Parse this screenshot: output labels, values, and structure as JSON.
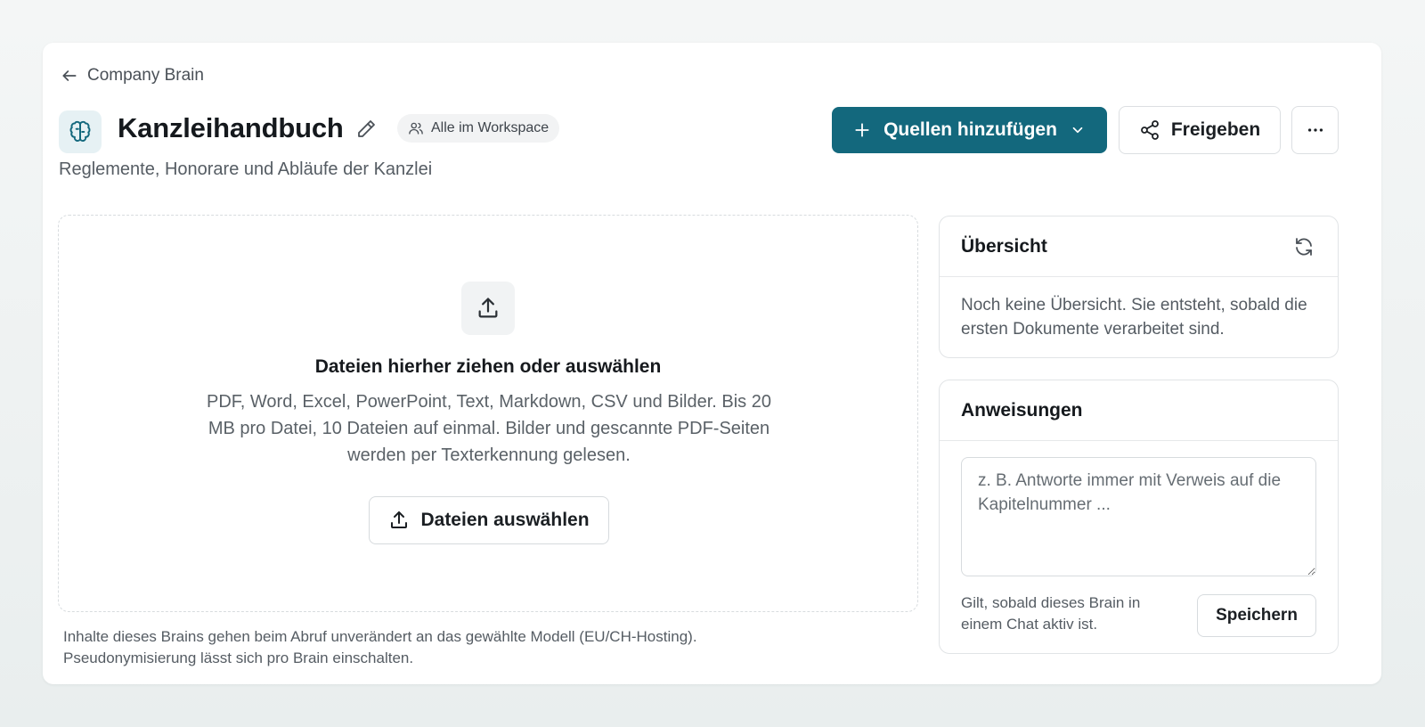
{
  "breadcrumb": {
    "back_label": "Company Brain"
  },
  "header": {
    "title": "Kanzleihandbuch",
    "visibility_label": "Alle im Workspace",
    "subtitle": "Reglemente, Honorare und Abläufe der Kanzlei"
  },
  "toolbar": {
    "add_sources_label": "Quellen hinzufügen",
    "share_label": "Freigeben",
    "more_label": "…"
  },
  "dropzone": {
    "title": "Dateien hierher ziehen oder auswählen",
    "description": "PDF, Word, Excel, PowerPoint, Text, Markdown, CSV und Bilder. Bis 20 MB pro Datei, 10 Dateien auf einmal. Bilder und gescannte PDF-Seiten werden per Texterkennung gelesen.",
    "button_label": "Dateien auswählen"
  },
  "footnote": {
    "line1": "Inhalte dieses Brains gehen beim Abruf unverändert an das gewählte Modell (EU/CH-Hosting).",
    "line2": "Pseudonymisierung lässt sich pro Brain einschalten."
  },
  "overview": {
    "title": "Übersicht",
    "empty_text": "Noch keine Übersicht. Sie entsteht, sobald die ersten Dokumente verarbeitet sind."
  },
  "instructions": {
    "title": "Anweisungen",
    "placeholder": "z. B. Antworte immer mit Verweis auf die Kapitelnummer ...",
    "value": "",
    "hint": "Gilt, sobald dieses Brain in einem Chat aktiv ist.",
    "save_label": "Speichern"
  },
  "colors": {
    "primary": "#13687d",
    "brain_badge_bg": "#e6f1f4",
    "brain_icon": "#13687d"
  },
  "icons": {
    "back": "arrow-left-icon",
    "brain": "brain-icon",
    "edit": "pencil-icon",
    "workspace": "users-icon",
    "add": "plus-icon",
    "dropdown": "chevron-down-icon",
    "share": "share-icon",
    "more": "ellipsis-icon",
    "upload": "upload-icon",
    "refresh": "refresh-icon"
  }
}
